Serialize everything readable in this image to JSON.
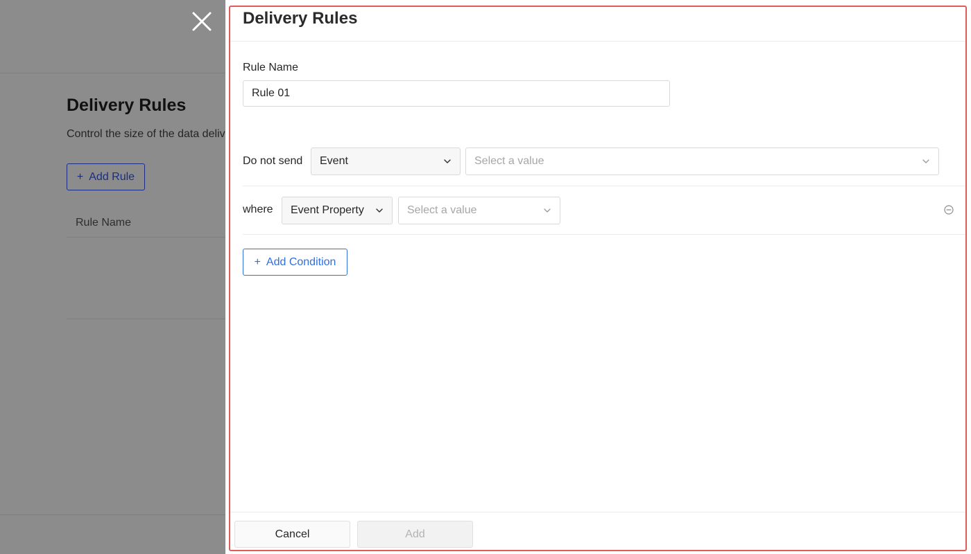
{
  "background": {
    "title": "Delivery Rules",
    "description": "Control the size of the data deliv",
    "add_rule_label": "Add Rule",
    "table_header_rule_name": "Rule Name"
  },
  "drawer": {
    "title": "Delivery Rules",
    "rule_name_label": "Rule Name",
    "rule_name_value": "Rule 01",
    "do_not_send_label": "Do not send",
    "event_type_value": "Event",
    "event_value_placeholder": "Select a value",
    "where_label": "where",
    "condition_type_value": "Event Property",
    "condition_value_placeholder": "Select a value",
    "add_condition_label": "Add Condition",
    "cancel_label": "Cancel",
    "add_label": "Add"
  },
  "icons": {
    "close": "close-icon",
    "chevron": "chevron-down-icon",
    "plus": "plus-icon",
    "remove": "minus-circle-icon"
  },
  "colors": {
    "accent": "#2f6fe0",
    "highlight": "#e05a5a"
  }
}
